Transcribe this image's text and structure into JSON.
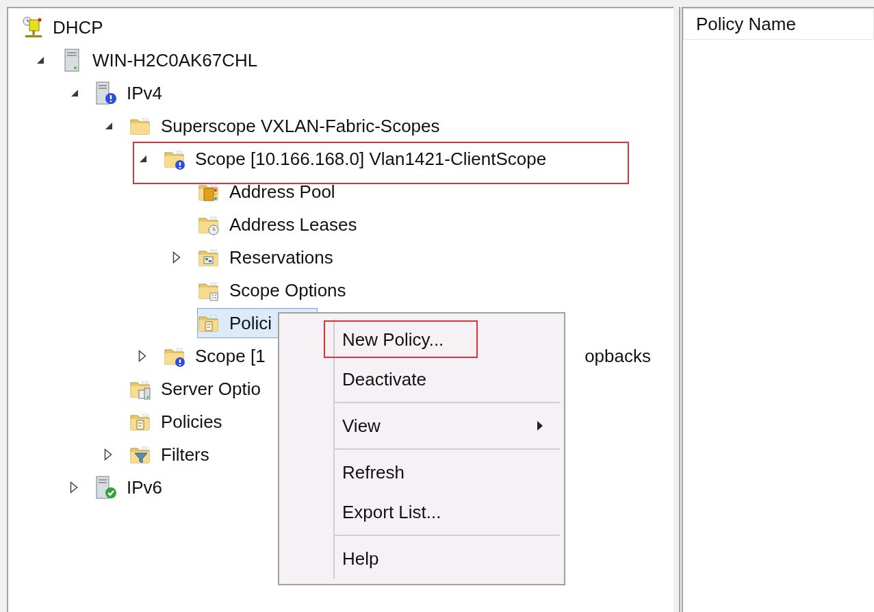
{
  "tree": [
    {
      "kind": "dhcp",
      "label": "DHCP",
      "selected": false,
      "children": [
        {
          "kind": "server",
          "label": "WIN-H2C0AK67CHL",
          "expanded": true,
          "selected": false,
          "children": [
            {
              "kind": "ipv4",
              "label": "IPv4",
              "expanded": true,
              "selected": false,
              "children": [
                {
                  "kind": "folder",
                  "label": "Superscope VXLAN-Fabric-Scopes",
                  "expanded": true,
                  "selected": false,
                  "children": [
                    {
                      "kind": "scope",
                      "label": "Scope [10.166.168.0] Vlan1421-ClientScope",
                      "expanded": true,
                      "selected": false,
                      "annotated": true,
                      "children": [
                        {
                          "kind": "pool",
                          "label": "Address Pool",
                          "selected": false
                        },
                        {
                          "kind": "leases",
                          "label": "Address Leases",
                          "selected": false
                        },
                        {
                          "kind": "reservations",
                          "label": "Reservations",
                          "expanded": false,
                          "selected": false
                        },
                        {
                          "kind": "options",
                          "label": "Scope Options",
                          "selected": false
                        },
                        {
                          "kind": "policies",
                          "label": "Polici",
                          "selected": true
                        }
                      ]
                    },
                    {
                      "kind": "scope",
                      "label": "Scope [1",
                      "label_tail": "opbacks",
                      "expanded": false,
                      "selected": false,
                      "annotated": false
                    }
                  ]
                },
                {
                  "kind": "server-options",
                  "label": "Server Optio",
                  "selected": false
                },
                {
                  "kind": "policies",
                  "label": "Policies",
                  "selected": false
                },
                {
                  "kind": "filters",
                  "label": "Filters",
                  "expanded": false,
                  "selected": false
                }
              ]
            },
            {
              "kind": "ipv6",
              "label": "IPv6",
              "expanded": false,
              "selected": false
            }
          ]
        }
      ]
    }
  ],
  "list": {
    "columns": [
      "Policy Name"
    ]
  },
  "context_menu": {
    "items": [
      {
        "kind": "item",
        "label": "New Policy...",
        "annotated": true
      },
      {
        "kind": "item",
        "label": "Deactivate"
      },
      {
        "kind": "separator"
      },
      {
        "kind": "item",
        "label": "View",
        "submenu": true
      },
      {
        "kind": "separator"
      },
      {
        "kind": "item",
        "label": "Refresh"
      },
      {
        "kind": "item",
        "label": "Export List..."
      },
      {
        "kind": "separator"
      },
      {
        "kind": "item",
        "label": "Help"
      }
    ]
  }
}
